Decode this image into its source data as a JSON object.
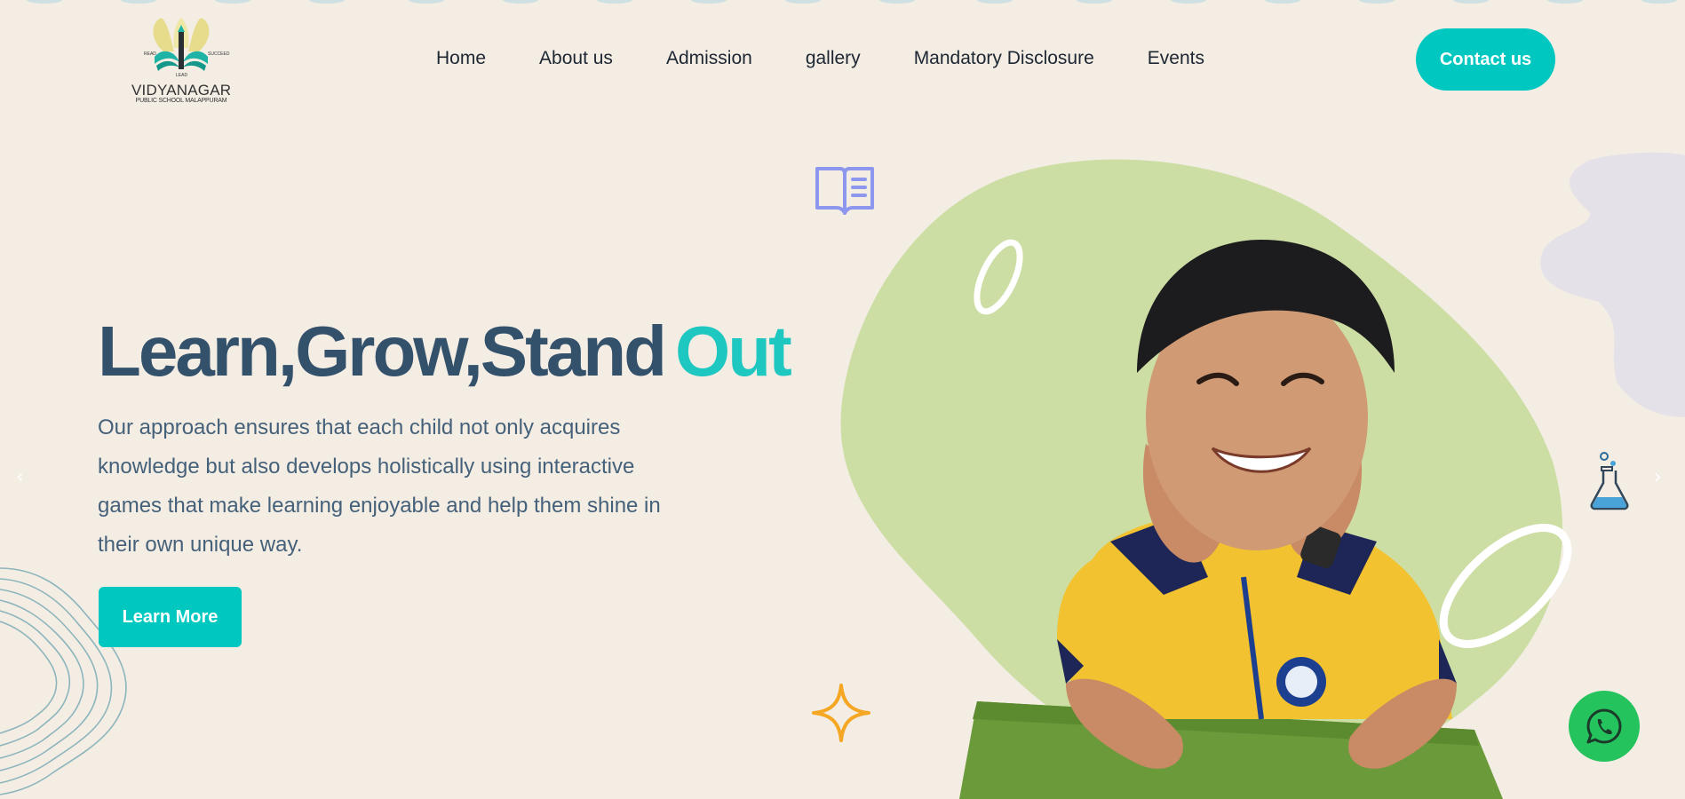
{
  "logo": {
    "name": "VIDYANAGAR",
    "subtitle": "PUBLIC SCHOOL MALAPPURAM",
    "tag_read": "READ",
    "tag_lead": "LEAD",
    "tag_succeed": "SUCCEED"
  },
  "nav": {
    "items": [
      {
        "label": "Home"
      },
      {
        "label": "About us"
      },
      {
        "label": "Admission"
      },
      {
        "label": "gallery"
      },
      {
        "label": "Mandatory Disclosure"
      },
      {
        "label": "Events"
      }
    ],
    "contact_label": "Contact us"
  },
  "hero": {
    "headline_main": "Learn,Grow,Stand",
    "headline_accent": "Out",
    "description": "Our approach ensures that each child not only acquires knowledge but also develops holistically using interactive games that make learning enjoyable and help them shine in their own unique way.",
    "button_label": "Learn More"
  },
  "carousel": {
    "prev_icon": "chevron-left-icon",
    "next_icon": "chevron-right-icon"
  },
  "colors": {
    "background": "#f4ede4",
    "accent": "#00c8c0",
    "heading": "#33516b",
    "blob_green": "#ccdea4",
    "blob_lavender": "#e4e1e8",
    "whatsapp": "#25c35d"
  }
}
